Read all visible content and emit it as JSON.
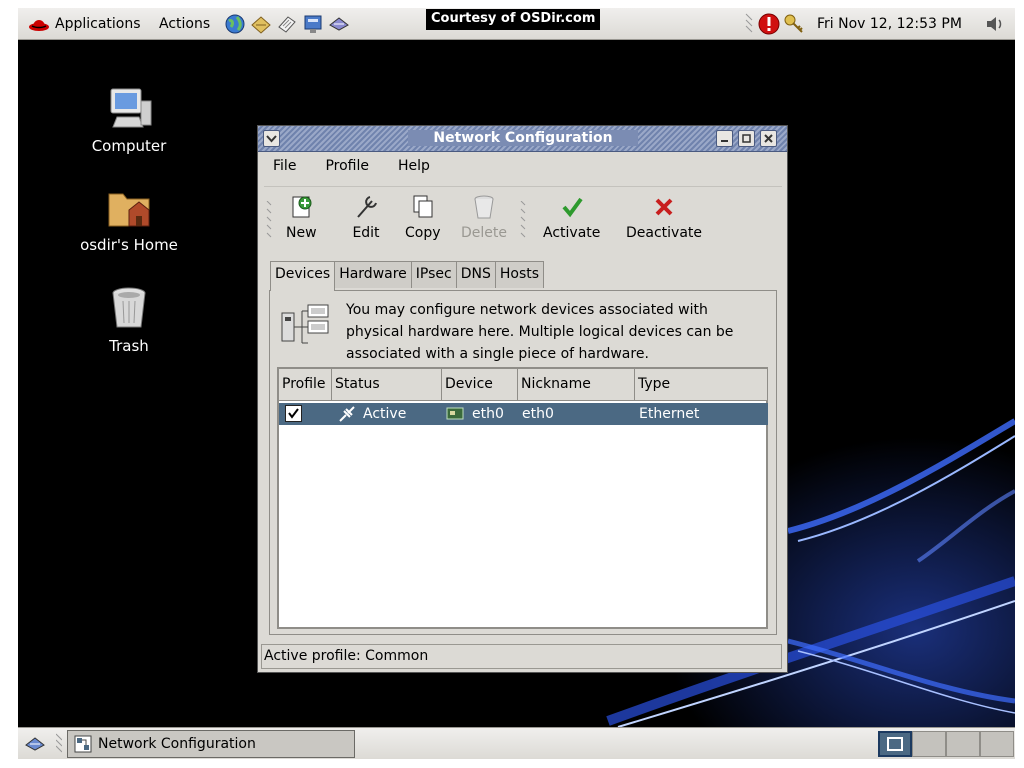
{
  "top_panel": {
    "applications_label": "Applications",
    "actions_label": "Actions",
    "launchers": [
      "web-browser-icon",
      "email-icon",
      "text-editor-icon",
      "presentation-icon",
      "office-icon"
    ],
    "courtesy_text": "Courtesy of OSDir.com",
    "clock": "Fri Nov 12, 12:53 PM",
    "tray_icons": [
      "alert-icon",
      "key-icon",
      "volume-icon"
    ]
  },
  "desktop": {
    "icons": [
      {
        "label": "Computer",
        "icon": "computer-icon"
      },
      {
        "label": "osdir's Home",
        "icon": "home-folder-icon"
      },
      {
        "label": "Trash",
        "icon": "trash-icon"
      }
    ]
  },
  "window": {
    "title": "Network Configuration",
    "menu": [
      "File",
      "Profile",
      "Help"
    ],
    "toolbar": {
      "new": "New",
      "edit": "Edit",
      "copy": "Copy",
      "delete": "Delete",
      "activate": "Activate",
      "deactivate": "Deactivate"
    },
    "tabs": [
      "Devices",
      "Hardware",
      "IPsec",
      "DNS",
      "Hosts"
    ],
    "active_tab": "Devices",
    "description": "You may configure network devices associated with physical hardware here.  Multiple logical devices can be associated with a single piece of hardware.",
    "table": {
      "columns": [
        "Profile",
        "Status",
        "Device",
        "Nickname",
        "Type"
      ],
      "rows": [
        {
          "profile_checked": true,
          "status": "Active",
          "device": "eth0",
          "nickname": "eth0",
          "type": "Ethernet"
        }
      ]
    },
    "status_bar": "Active profile: Common"
  },
  "bottom_panel": {
    "task_label": "Network Configuration",
    "workspaces": 4,
    "active_workspace": 1
  },
  "colors": {
    "selection": "#4b6983",
    "panel": "#dcdad5",
    "titlebar": "#7b8cb3"
  }
}
